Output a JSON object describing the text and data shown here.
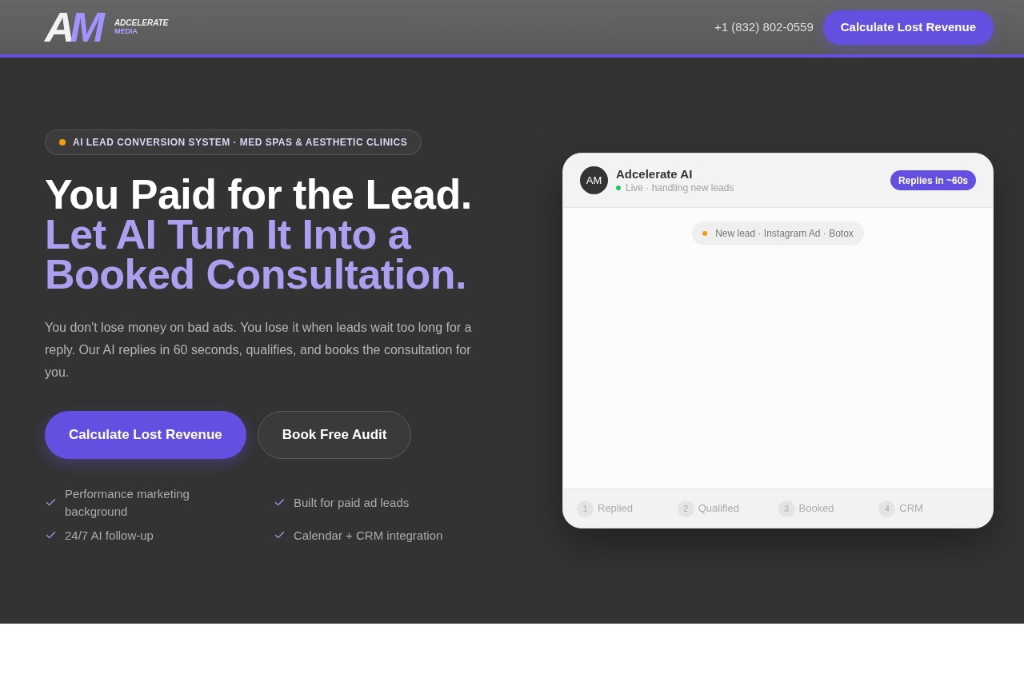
{
  "header": {
    "logo": {
      "mark": "AM",
      "name": "ADCELERATE",
      "tagline": "MEDIA"
    },
    "phone": "+1 (832) 802-0559",
    "cta": "Calculate Lost Revenue"
  },
  "hero": {
    "badge": "AI LEAD CONVERSION SYSTEM · MED SPAS & AESTHETIC CLINICS",
    "headline": "You Paid for the Lead.",
    "headline_highlight": "Let AI Turn It Into a Booked Consultation.",
    "description": "You don't lose money on bad ads. You lose it when leads wait too long for a reply. Our AI replies in 60 seconds, qualifies, and books the consultation for you.",
    "buttons": [
      {
        "label": "Calculate Lost Revenue",
        "kind": "primary"
      },
      {
        "label": "Book Free Audit",
        "kind": "secondary"
      }
    ],
    "features": [
      "Performance marketing background",
      "Built for paid ad leads",
      "24/7 AI follow-up",
      "Calendar + CRM integration"
    ]
  },
  "chat_preview": {
    "avatar": "AM",
    "name": "Adcelerate AI",
    "status": "Live · handling new leads",
    "badge": "Replies in ~60s",
    "lead_tag": "New lead · Instagram Ad · Botox",
    "steps": [
      {
        "number": "1",
        "label": "Replied"
      },
      {
        "number": "2",
        "label": "Qualified"
      },
      {
        "number": "3",
        "label": "Booked"
      },
      {
        "number": "4",
        "label": "CRM"
      }
    ]
  }
}
